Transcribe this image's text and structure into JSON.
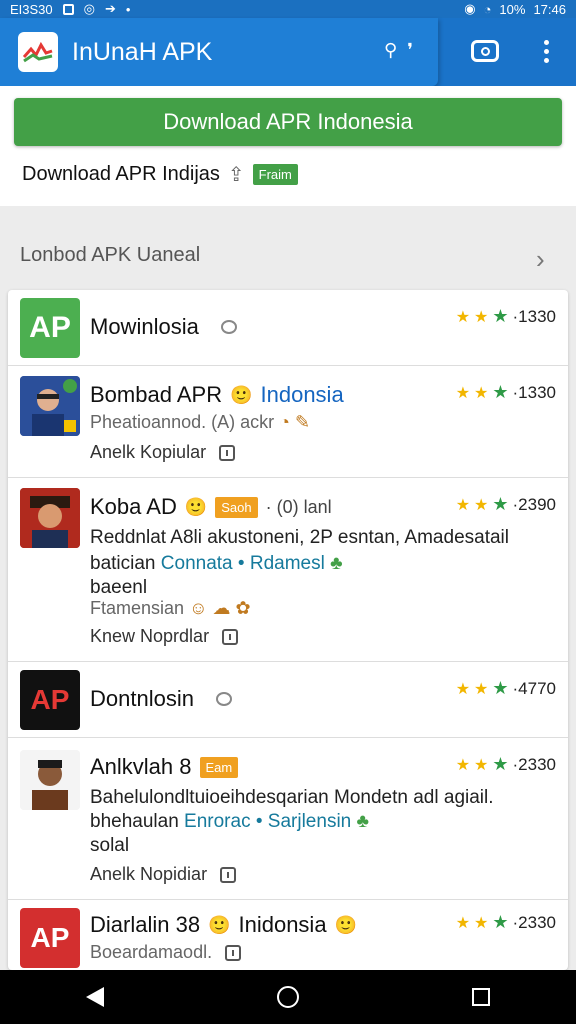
{
  "status_bar": {
    "left_text": "EI3S30",
    "battery": "10%",
    "time": "17:46"
  },
  "app_bar": {
    "title": "InUnaH APK",
    "search_icon": "search-icon",
    "mic_icon": "mic-icon",
    "camera_icon": "camera-icon",
    "more_icon": "more-vert-icon"
  },
  "top": {
    "download_label": "Download APR Indonesia",
    "subline": "Download APR Indijas",
    "free_badge": "Fraim"
  },
  "section": {
    "title": "Lonbod APK Uaneal"
  },
  "apps": [
    {
      "title": "Mowinlosia",
      "rating": "·1330",
      "icon_text": "AP"
    },
    {
      "title": "Bombad APR",
      "title_accent": "Indonsia",
      "rating": "·1330",
      "meta1": "Pheatioannod.  (A) ackr",
      "meta2": "Anelk Kopiular"
    },
    {
      "title": "Koba AD",
      "badge": "Saoh",
      "title_extra": "· (0) lanl",
      "rating": "·2390",
      "desc1": "Reddnlat A8li akustoneni, 2P esntan, Amadesatail",
      "desc2_a": "batician",
      "desc2_b": "Connata",
      "desc2_c": "Rdamesl",
      "desc3": "baeenl",
      "meta1": "Ftamensian",
      "meta2": "Knew Noprdlar"
    },
    {
      "title": "Dontnlosin",
      "rating": "·4770",
      "icon_text": "AP"
    },
    {
      "title": "Anlkvlah 8",
      "badge": "Eam",
      "rating": "·2330",
      "desc1": "Bahelulondltuioeihdesqarian Mondetn adl  agiail.",
      "desc2_a": "bhehaulan",
      "desc2_b": "Enrorac",
      "desc2_c": "Sarjlensin",
      "desc3": "solal",
      "meta2": "Anelk Nopidiar"
    },
    {
      "title": "Diarlalin 38",
      "title_accent": "Inidonsia",
      "rating": "·2330",
      "meta1": "Boeardamaodl.",
      "icon_text": "AP"
    }
  ]
}
